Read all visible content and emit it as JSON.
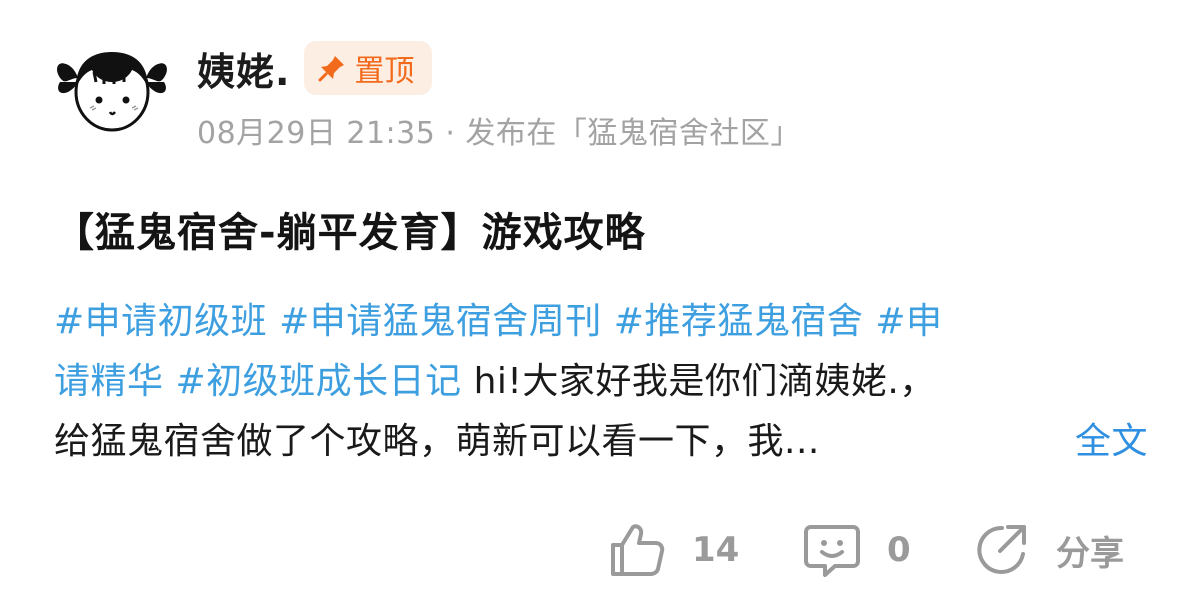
{
  "author": {
    "name": "姨姥.",
    "pin_label": "置顶"
  },
  "meta": {
    "date": "08月29日 21:35",
    "separator": "·",
    "posted_in": "发布在「猛鬼宿舍社区」"
  },
  "post": {
    "title": "【猛鬼宿舍-躺平发育】游戏攻略",
    "hashtags": [
      "#申请初级班",
      "#申请猛鬼宿舍周刊",
      "#推荐猛鬼宿舍",
      "#申",
      "请精华",
      "#初级班成长日记"
    ],
    "text_line2": "hi!大家好我是你们滴姨姥.，",
    "text_line3": "给猛鬼宿舍做了个攻略，萌新可以看一下，我...",
    "full_text_label": "全文"
  },
  "actions": {
    "like_count": "14",
    "comment_count": "0",
    "share_label": "分享"
  },
  "colors": {
    "hashtag": "#3d9fe0",
    "pin_text": "#f26a1b",
    "pin_bg": "#fdeee4",
    "meta": "#a3a3a3",
    "action": "#9a9a9a"
  },
  "icons": {
    "avatar": "cartoon-girl-avatar",
    "pin": "pushpin-icon",
    "like": "thumbs-up-icon",
    "comment": "chat-bubble-smile-icon",
    "share": "share-arrow-icon"
  }
}
